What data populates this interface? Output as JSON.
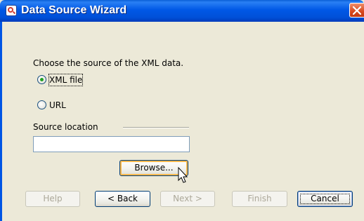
{
  "window": {
    "title": "Data Source Wizard",
    "titlebar_color": "#0054e3",
    "close_color": "#d8471d"
  },
  "wizard": {
    "prompt": "Choose the source of the XML data.",
    "options": [
      {
        "label": "XML file",
        "checked": true
      },
      {
        "label": "URL",
        "checked": false
      }
    ],
    "source_location": {
      "label": "Source location",
      "value": ""
    },
    "browse_label": "Browse..."
  },
  "footer": {
    "help": "Help",
    "back": "< Back",
    "next": "Next >",
    "finish": "Finish",
    "cancel": "Cancel"
  }
}
